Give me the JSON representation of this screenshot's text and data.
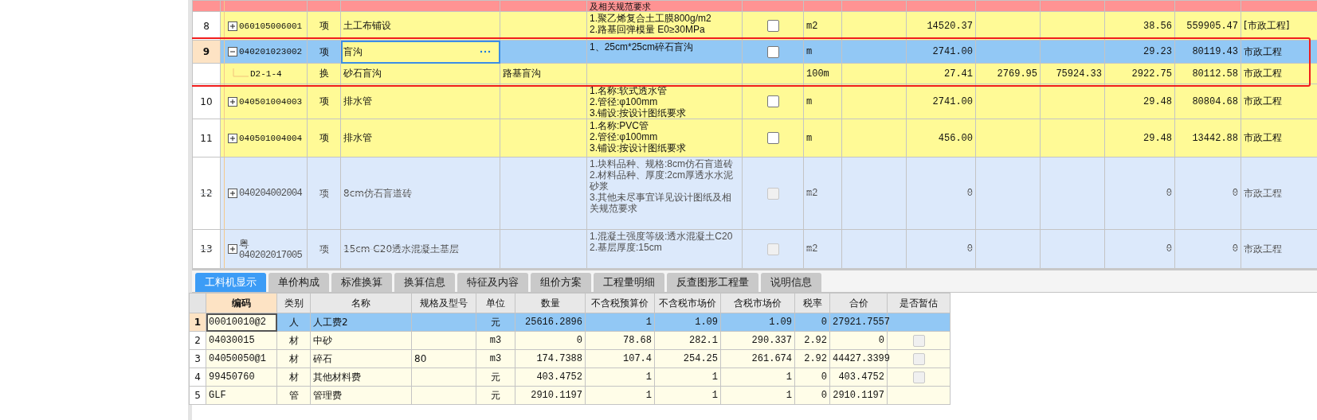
{
  "top_partial_row": {
    "feature": "及相关规范要求"
  },
  "rows": [
    {
      "num": "8",
      "kind": "item",
      "expanded": false,
      "code": "060105006001",
      "type": "项",
      "name": "土工布铺设",
      "feature": [
        "1.聚乙烯复合土工膜800g/m2",
        "2.路基回弹模量 E0≥30MPa"
      ],
      "checked": false,
      "unit": "m2",
      "quantity": "14520.37",
      "unit_price": "38.56",
      "total": "559905.47",
      "category": "[市政工程]",
      "selected": false,
      "disabled": false,
      "editing": false
    },
    {
      "num": "9",
      "kind": "item",
      "expanded": true,
      "code": "040201023002",
      "type": "项",
      "name": "盲沟",
      "feature": [
        "1、25cm*25cm碎石盲沟"
      ],
      "checked": false,
      "unit": "m",
      "quantity": "2741.00",
      "unit_price": "29.23",
      "total": "80119.43",
      "category": "市政工程",
      "selected": true,
      "disabled": false,
      "editing": true
    },
    {
      "kind": "sub",
      "code": "D2-1-4",
      "type": "换",
      "name": "砂石盲沟",
      "spec": "路基盲沟",
      "unit": "100m",
      "quantity": "27.41",
      "column_11": "2769.95",
      "column_12": "75924.33",
      "unit_price": "2922.75",
      "total": "80112.58",
      "category": "市政工程",
      "selected": false,
      "disabled": false,
      "editing": false
    },
    {
      "num": "10",
      "kind": "item",
      "expanded": false,
      "code": "040501004003",
      "type": "项",
      "name": "排水管",
      "feature": [
        "1.名称:软式透水管",
        "2.管径:φ100mm",
        "3.铺设:按设计图纸要求"
      ],
      "checked": false,
      "unit": "m",
      "quantity": "2741.00",
      "unit_price": "29.48",
      "total": "80804.68",
      "category": "市政工程",
      "selected": false,
      "disabled": false,
      "editing": false
    },
    {
      "num": "11",
      "kind": "item",
      "expanded": false,
      "code": "040501004004",
      "type": "项",
      "name": "排水管",
      "feature": [
        "1.名称:PVC管",
        "2.管径:φ100mm",
        "3.铺设:按设计图纸要求"
      ],
      "checked": false,
      "unit": "m",
      "quantity": "456.00",
      "unit_price": "29.48",
      "total": "13442.88",
      "category": "市政工程",
      "selected": false,
      "disabled": false,
      "editing": false
    },
    {
      "num": "12",
      "kind": "item",
      "expanded": false,
      "code": "040204002004",
      "type": "项",
      "name": "8cm仿石盲道砖",
      "feature": [
        "1.块料品种、规格:8cm仿石盲道砖",
        "2.材料品种、厚度:2cm厚透水水泥砂浆",
        "3.其他未尽事宜详见设计图纸及相关规范要求"
      ],
      "checked": false,
      "unit": "m2",
      "quantity": "0",
      "unit_price": "0",
      "total": "0",
      "category": "市政工程",
      "selected": false,
      "disabled": true,
      "editing": false
    },
    {
      "num": "13",
      "kind": "item",
      "expanded": false,
      "prefix": "粤",
      "code": "040202017005",
      "type": "项",
      "name": "15cm C20透水混凝土基层",
      "feature": [
        "1.混凝土强度等级:透水混凝土C20",
        "2.基层厚度:15cm"
      ],
      "checked": false,
      "unit": "m2",
      "quantity": "0",
      "unit_price": "0",
      "total": "0",
      "category": "市政工程",
      "selected": false,
      "disabled": true,
      "editing": false
    }
  ],
  "tabs": [
    {
      "label": "工料机显示",
      "selected": true
    },
    {
      "label": "单价构成",
      "selected": false
    },
    {
      "label": "标准换算",
      "selected": false
    },
    {
      "label": "换算信息",
      "selected": false
    },
    {
      "label": "特征及内容",
      "selected": false
    },
    {
      "label": "组价方案",
      "selected": false
    },
    {
      "label": "工程量明细",
      "selected": false
    },
    {
      "label": "反查图形工程量",
      "selected": false
    },
    {
      "label": "说明信息",
      "selected": false
    }
  ],
  "resource_table": {
    "columns": [
      {
        "label": "编码",
        "current": true
      },
      {
        "label": "类别",
        "current": false
      },
      {
        "label": "名称",
        "current": false
      },
      {
        "label": "规格及型号",
        "current": false
      },
      {
        "label": "单位",
        "current": false
      },
      {
        "label": "数量",
        "current": false
      },
      {
        "label": "不含税预算价",
        "current": false
      },
      {
        "label": "不含税市场价",
        "current": false
      },
      {
        "label": "含税市场价",
        "current": false
      },
      {
        "label": "税率",
        "current": false
      },
      {
        "label": "合价",
        "current": false
      },
      {
        "label": "是否暂估",
        "current": false
      }
    ],
    "rows": [
      {
        "num": "1",
        "cells": [
          "00010010@2",
          "人",
          "人工费2",
          "",
          "元",
          "25616.2896",
          "1",
          "1.09",
          "1.09",
          "0",
          "27921.7557"
        ],
        "selected": true
      },
      {
        "num": "2",
        "cells": [
          "04030015",
          "材",
          "中砂",
          "",
          "m3",
          "0",
          "78.68",
          "282.1",
          "290.337",
          "2.92",
          "0"
        ],
        "provisional_checked": false,
        "selected": false
      },
      {
        "num": "3",
        "cells": [
          "04050050@1",
          "材",
          "碎石",
          "80",
          "m3",
          "174.7388",
          "107.4",
          "254.25",
          "261.674",
          "2.92",
          "44427.3399"
        ],
        "provisional_checked": false,
        "selected": false
      },
      {
        "num": "4",
        "cells": [
          "99450760",
          "材",
          "其他材料费",
          "",
          "元",
          "403.4752",
          "1",
          "1",
          "1",
          "0",
          "403.4752"
        ],
        "provisional_checked": false,
        "selected": false
      },
      {
        "num": "5",
        "cells": [
          "GLF",
          "管",
          "管理费",
          "",
          "元",
          "2910.1197",
          "1",
          "1",
          "1",
          "0",
          "2910.1197"
        ],
        "selected": false
      }
    ]
  }
}
